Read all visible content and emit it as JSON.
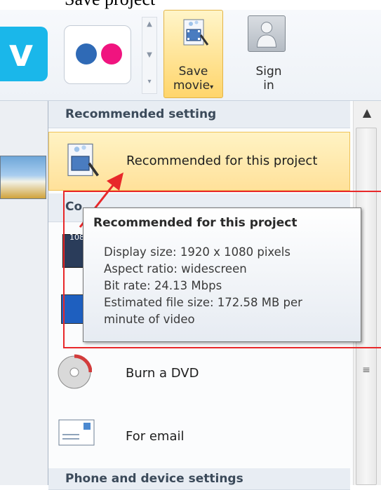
{
  "caption": {
    "text": "Save project"
  },
  "ribbon": {
    "save": {
      "line1": "Save",
      "line2": "movie",
      "arrow": "▾"
    },
    "signin": {
      "line1": "Sign",
      "line2": "in"
    },
    "gallery_scroll": {
      "up": "▲",
      "down": "▼",
      "more": "▾"
    },
    "icons": [
      "vimeo-icon",
      "flickr-icon",
      "save-movie-icon",
      "windows-live-user-icon"
    ],
    "colors": {
      "vimeo": "#1ab7ea",
      "flickr_blue": "#2f6ab6",
      "flickr_pink": "#f0147f",
      "save_highlight": "#ffd56b"
    }
  },
  "menu": {
    "header_recommended": "Recommended setting",
    "item_recommended": "Recommended for this project",
    "partial_header": "Co",
    "partial_label_1080": "108",
    "item_dvd": "Burn a DVD",
    "item_email": "For email",
    "header_phone": "Phone and device settings",
    "scroll_up": "▲",
    "scroll_grip": "≡"
  },
  "tooltip": {
    "title": "Recommended for this project",
    "lines": [
      "Display size: 1920 x 1080 pixels",
      "Aspect ratio: widescreen",
      "Bit rate: 24.13 Mbps",
      "Estimated file size: 172.58 MB per",
      "minute of video"
    ]
  },
  "annotation": {
    "color": "#e8282a"
  }
}
